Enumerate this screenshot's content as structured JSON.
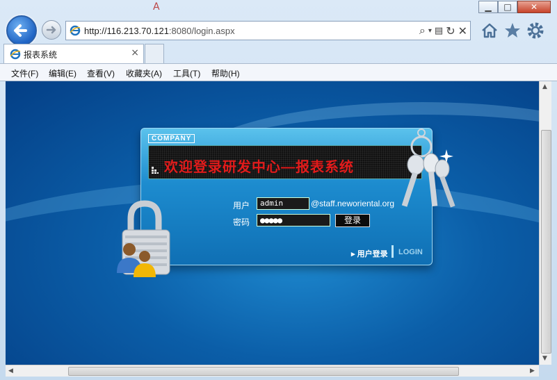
{
  "window": {
    "minimize_glyph": "▁",
    "maximize_glyph": "□",
    "close_glyph": "✕"
  },
  "nav": {
    "back_icon": "arrow-left-icon",
    "forward_icon": "arrow-right-icon"
  },
  "address_bar": {
    "url_main": "http://116.213.70.121",
    "url_rest": ":8080/login.aspx"
  },
  "tab": {
    "title": "报表系统",
    "close_glyph": "×"
  },
  "menu": {
    "items": [
      "文件(F)",
      "编辑(E)",
      "查看(V)",
      "收藏夹(A)",
      "工具(T)",
      "帮助(H)"
    ]
  },
  "login": {
    "company_label": "COMPANY",
    "title": "欢迎登录研发中心—报表系统",
    "user_label": "用户",
    "user_value": "admin",
    "user_suffix": "@staff.neworiental.org",
    "password_label": "密码",
    "password_mask": "●●●●●",
    "login_button": "登录",
    "user_login_link": "▸ 用户登录",
    "login_link": "LOGIN"
  },
  "colors": {
    "accent": "#1d8ccf",
    "title_red": "#e21b1b"
  }
}
